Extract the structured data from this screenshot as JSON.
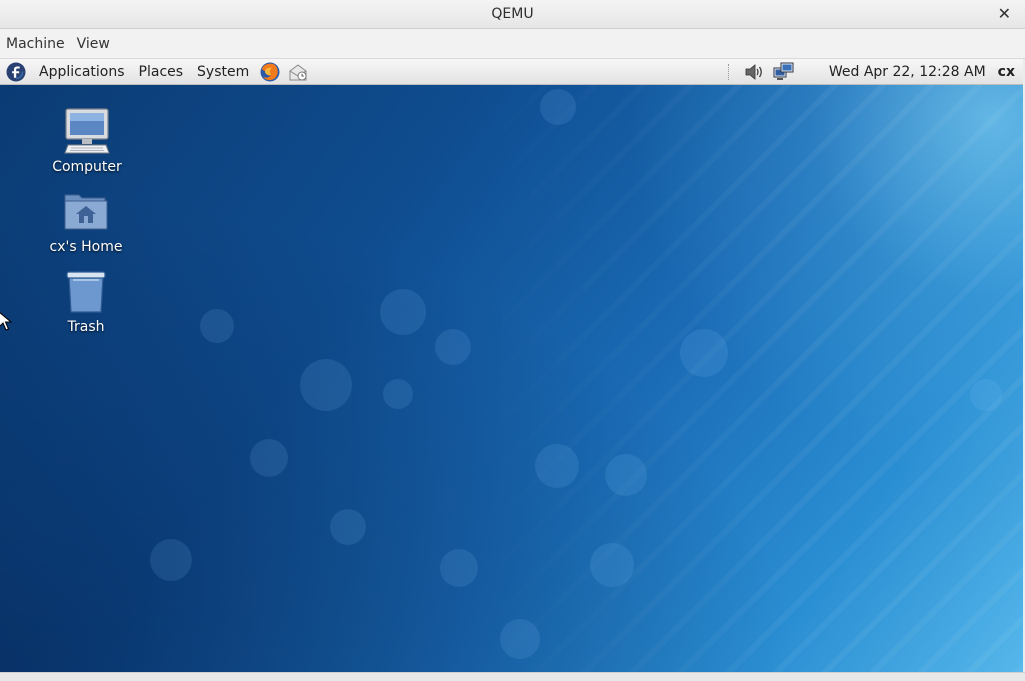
{
  "window": {
    "title": "QEMU",
    "close_glyph": "✕",
    "menu": [
      "Machine",
      "View"
    ]
  },
  "panel": {
    "menus": [
      "Applications",
      "Places",
      "System"
    ],
    "launchers": [
      "firefox-icon",
      "mail-client-icon"
    ],
    "tray": [
      "volume-icon",
      "network-icon"
    ],
    "clock": "Wed Apr 22, 12:28 AM",
    "user": "cx"
  },
  "desktop": {
    "icons": [
      {
        "label": "Computer",
        "icon": "computer-icon"
      },
      {
        "label": "cx's Home",
        "icon": "home-folder-icon"
      },
      {
        "label": "Trash",
        "icon": "trash-icon"
      }
    ]
  },
  "colors": {
    "wallpaper_dark": "#0b3a72",
    "wallpaper_light": "#55b7ea",
    "fedora_blue": "#294172"
  }
}
